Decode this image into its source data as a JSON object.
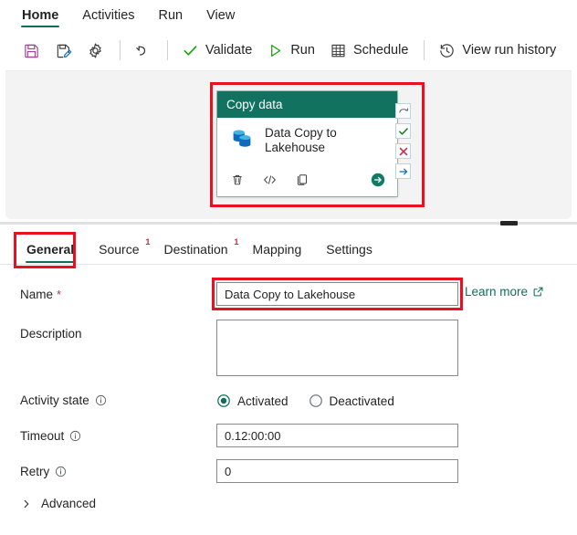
{
  "ribbon": {
    "tabs": [
      {
        "label": "Home",
        "active": true
      },
      {
        "label": "Activities",
        "active": false
      },
      {
        "label": "Run",
        "active": false
      },
      {
        "label": "View",
        "active": false
      }
    ]
  },
  "commandbar": {
    "buttons": [
      {
        "label": "",
        "icon": "save-icon",
        "name": "save-button"
      },
      {
        "label": "",
        "icon": "save-as-icon",
        "name": "save-as-button"
      },
      {
        "label": "",
        "icon": "gear-icon",
        "name": "settings-button"
      },
      {
        "label": "",
        "icon": "undo-icon",
        "name": "undo-button"
      },
      {
        "label": "Validate",
        "icon": "checkmark-icon",
        "name": "validate-button"
      },
      {
        "label": "Run",
        "icon": "play-icon",
        "name": "run-button"
      },
      {
        "label": "Schedule",
        "icon": "calendar-icon",
        "name": "schedule-button"
      },
      {
        "label": "View run history",
        "icon": "history-icon",
        "name": "view-run-history-button"
      }
    ]
  },
  "canvas": {
    "activity": {
      "header": "Copy data",
      "title": "Data Copy to Lakehouse",
      "icon": "database-copy-icon",
      "actions": [
        {
          "name": "delete-activity-icon",
          "icon": "trash-icon"
        },
        {
          "name": "code-view-icon",
          "icon": "code-icon"
        },
        {
          "name": "clone-activity-icon",
          "icon": "copy-icon"
        },
        {
          "name": "run-activity-icon",
          "icon": "arrow-circle-right-icon"
        }
      ]
    },
    "connectors": [
      {
        "name": "on-completion-connector",
        "icon": "curved-arrow-icon",
        "color": "#5a6066"
      },
      {
        "name": "on-success-connector",
        "icon": "check-icon",
        "color": "#107c10"
      },
      {
        "name": "on-failure-connector",
        "icon": "x-icon",
        "color": "#c4314b"
      },
      {
        "name": "on-skip-connector",
        "icon": "arrow-right-icon",
        "color": "#0f6cbd"
      }
    ]
  },
  "properties": {
    "tabs": [
      {
        "label": "General",
        "badge": "",
        "active": true
      },
      {
        "label": "Source",
        "badge": "1",
        "active": false
      },
      {
        "label": "Destination",
        "badge": "1",
        "active": false
      },
      {
        "label": "Mapping",
        "badge": "",
        "active": false
      },
      {
        "label": "Settings",
        "badge": "",
        "active": false
      }
    ],
    "fields": {
      "name": {
        "label": "Name",
        "required": "*",
        "value": "Data Copy to Lakehouse",
        "placeholder": ""
      },
      "description": {
        "label": "Description",
        "value": "",
        "placeholder": ""
      },
      "activity_state": {
        "label": "Activity state",
        "options": [
          {
            "label": "Activated",
            "selected": true
          },
          {
            "label": "Deactivated",
            "selected": false
          }
        ]
      },
      "timeout": {
        "label": "Timeout",
        "value": "0.12:00:00",
        "placeholder": ""
      },
      "retry": {
        "label": "Retry",
        "value": "0",
        "placeholder": ""
      }
    },
    "learn_more": "Learn more",
    "advanced": "Advanced"
  },
  "colors": {
    "accent_teal": "#0f6e5c",
    "activity_header": "#10725f",
    "annotation_red": "#e81123",
    "badge_red": "#c4314b",
    "canvas_bg": "#f3f3f3"
  }
}
